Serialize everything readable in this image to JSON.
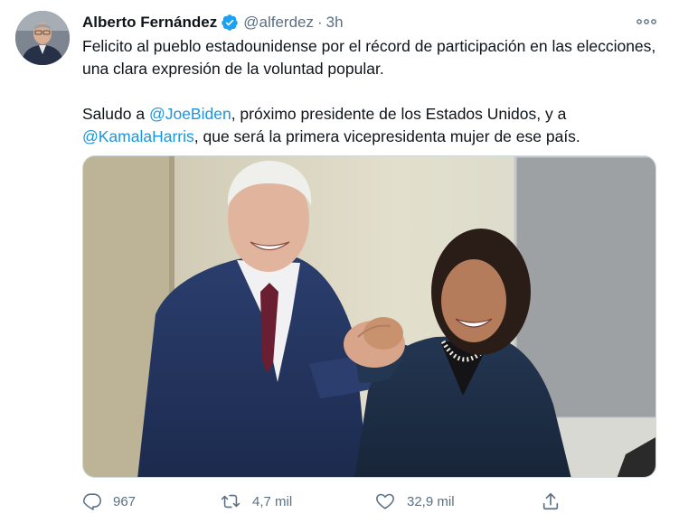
{
  "tweet": {
    "author_name": "Alberto Fernández",
    "handle": "@alferdez",
    "separator": "·",
    "time": "3h",
    "paragraph1": "Felicito al pueblo estadounidense por el récord de participación en las elecciones, una clara expresión de la voluntad popular.",
    "paragraph2": {
      "lead": "Saludo a ",
      "mention1": "@JoeBiden",
      "middle": ", próximo presidente de los Estados Unidos, y a ",
      "mention2": "@KamalaHarris",
      "end": ", que será la primera vicepresidenta mujer de ese país."
    }
  },
  "actions": {
    "reply": {
      "icon": "reply-icon",
      "count": "967"
    },
    "retweet": {
      "icon": "retweet-icon",
      "count": "4,7 mil"
    },
    "like": {
      "icon": "heart-icon",
      "count": "32,9 mil"
    },
    "share": {
      "icon": "share-icon"
    }
  },
  "colors": {
    "text": "#0f1419",
    "secondary": "#5b7083",
    "link": "#1b95e0",
    "verified": "#1da1f2"
  }
}
